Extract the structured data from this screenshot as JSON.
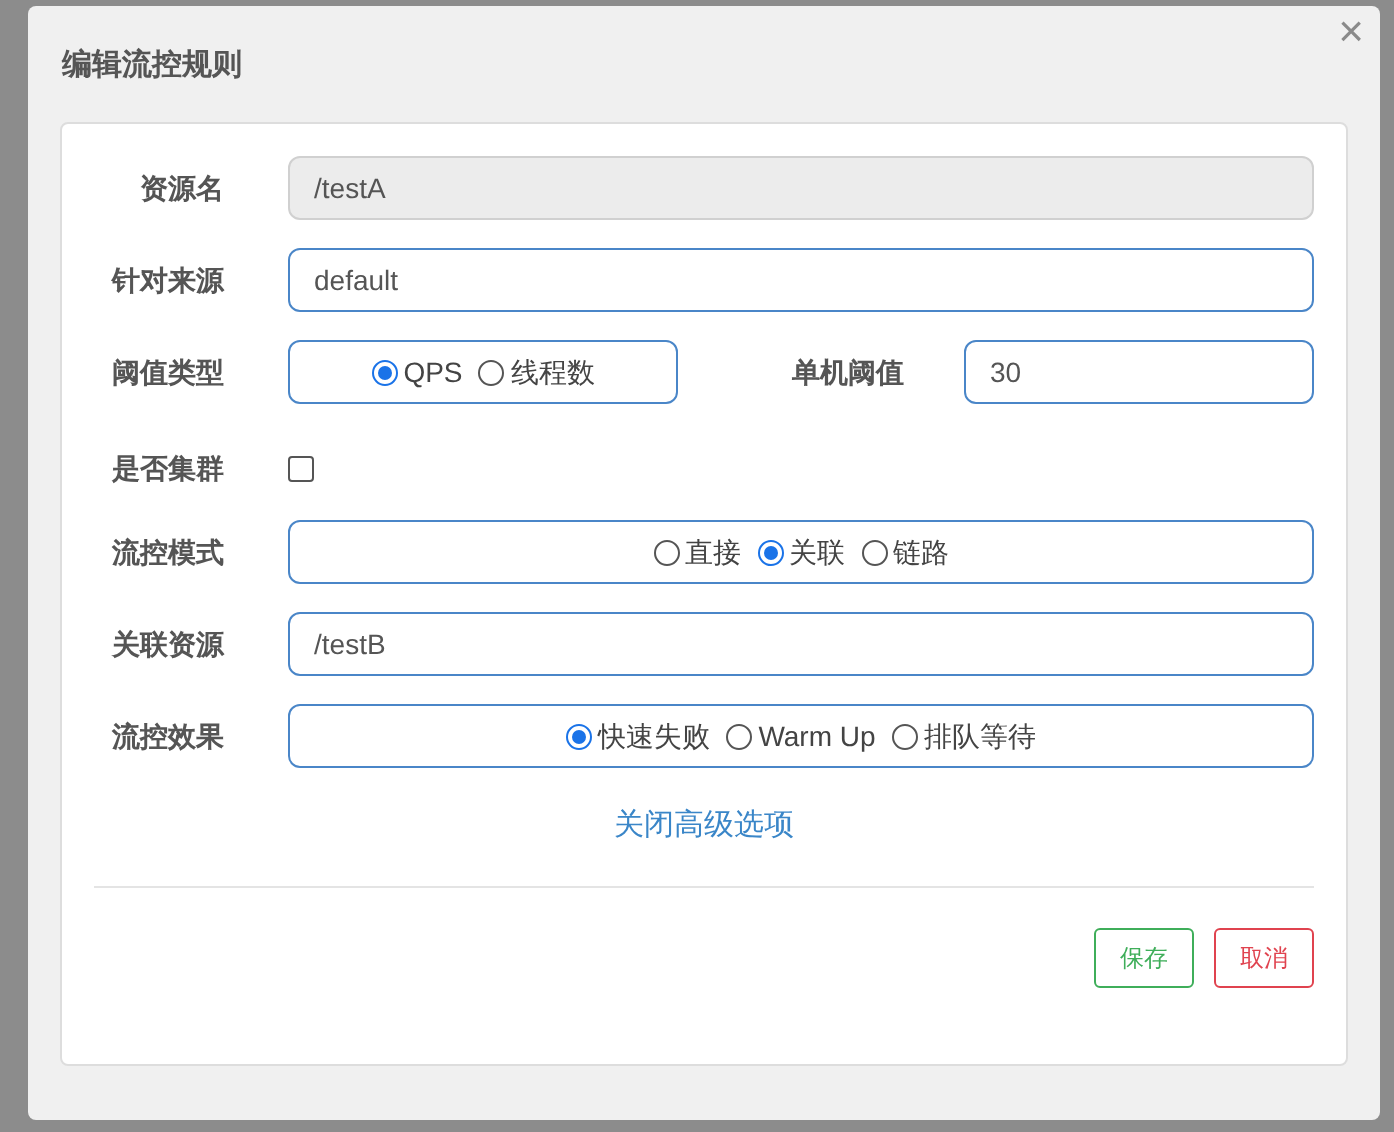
{
  "dialog": {
    "title": "编辑流控规则",
    "close": "×"
  },
  "fields": [
    {
      "kind": "input",
      "label": "资源名",
      "value": "/testA",
      "disabled": true
    },
    {
      "kind": "input",
      "label": "针对来源",
      "value": "default",
      "disabled": false
    },
    {
      "kind": "radio_input",
      "label": "阈值类型",
      "options": [
        {
          "label": "QPS",
          "selected": true
        },
        {
          "label": "线程数",
          "selected": false
        }
      ],
      "label_2": "单机阈值",
      "value": "30"
    },
    {
      "kind": "checkbox",
      "label": "是否集群",
      "checked": false
    },
    {
      "kind": "radio",
      "label": "流控模式",
      "options": [
        {
          "label": "直接",
          "selected": false
        },
        {
          "label": "关联",
          "selected": true
        },
        {
          "label": "链路",
          "selected": false
        }
      ]
    },
    {
      "kind": "input",
      "label": "关联资源",
      "value": "/testB",
      "disabled": false
    },
    {
      "kind": "radio",
      "label": "流控效果",
      "options": [
        {
          "label": "快速失败",
          "selected": true
        },
        {
          "label": "Warm Up",
          "selected": false
        },
        {
          "label": "排队等待",
          "selected": false
        }
      ]
    }
  ],
  "advanced_link": "关闭高级选项",
  "buttons": [
    {
      "label": "保存",
      "kind": "save"
    },
    {
      "label": "取消",
      "kind": "cancel"
    }
  ]
}
